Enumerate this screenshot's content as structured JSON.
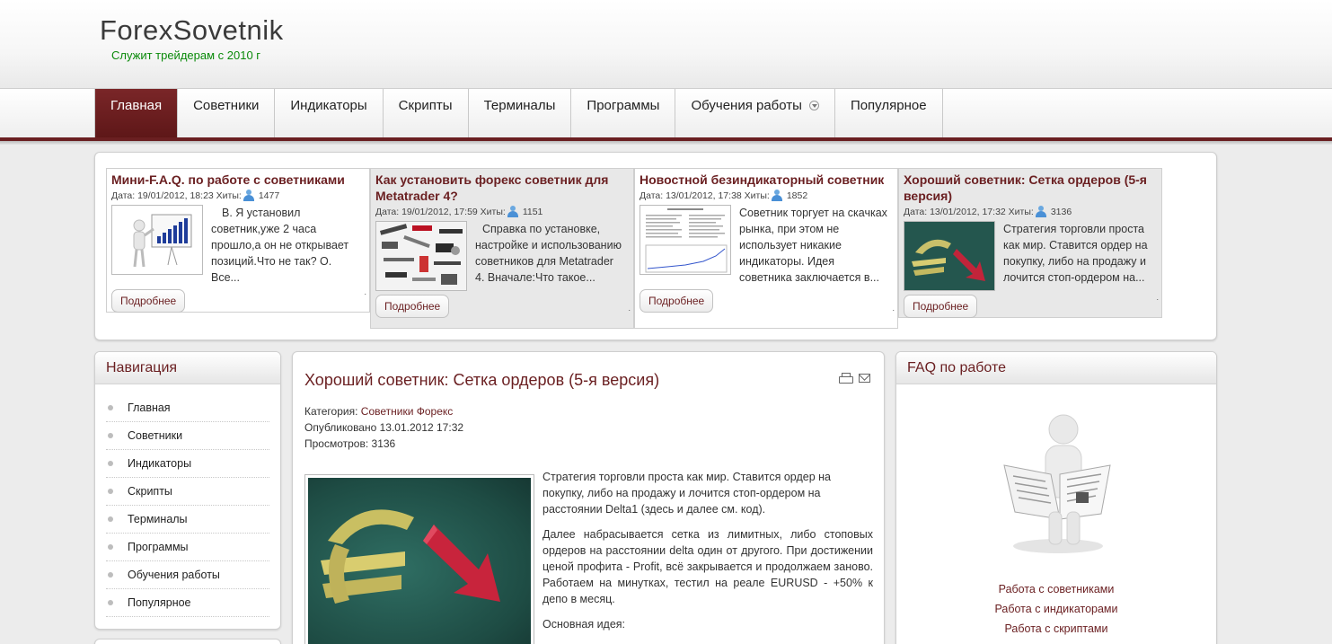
{
  "site": {
    "logo": "ForexSovetnik",
    "slogan": "Служит трейдерам с 2010 г"
  },
  "menu": [
    {
      "label": "Главная"
    },
    {
      "label": "Советники"
    },
    {
      "label": "Индикаторы"
    },
    {
      "label": "Скрипты"
    },
    {
      "label": "Терминалы"
    },
    {
      "label": "Программы"
    },
    {
      "label": "Обучения работы"
    },
    {
      "label": "Популярное"
    }
  ],
  "featured": [
    {
      "title": "Мини-F.A.Q. по работе с советниками",
      "meta": "Дата: 19/01/2012, 18:23 Хиты:",
      "hits": "1477",
      "text": "В. Я установил советник,уже 2 часа прошло,а он не открывает позиций.Что не так? О. Все...",
      "more": "Подробнее"
    },
    {
      "title": "Как установить форекс советник для Metatrader 4?",
      "meta": "Дата: 19/01/2012, 17:59 Хиты:",
      "hits": "1151",
      "text": "Справка по установке, настройке и использованию советников для Metatrader 4. Вначале:Что такое...",
      "more": "Подробнее"
    },
    {
      "title": "Новостной безиндикаторный советник",
      "meta": "Дата: 13/01/2012, 17:38 Хиты:",
      "hits": "1852",
      "text": "Советник торгует на скачках рынка, при этом не использует никакие индикаторы. Идея советника заключается в...",
      "more": "Подробнее"
    },
    {
      "title": "Хороший советник: Сетка ордеров (5-я версия)",
      "meta": "Дата: 13/01/2012, 17:32 Хиты:",
      "hits": "3136",
      "text": "Стратегия торговли проста как мир. Ставится ордер на покупку, либо на продажу и лочится стоп-ордером на...",
      "more": "Подробнее"
    }
  ],
  "sidebar_nav": {
    "title": "Навигация",
    "items": [
      {
        "label": "Главная"
      },
      {
        "label": "Советники"
      },
      {
        "label": "Индикаторы"
      },
      {
        "label": "Скрипты"
      },
      {
        "label": "Терминалы"
      },
      {
        "label": "Программы"
      },
      {
        "label": "Обучения работы"
      },
      {
        "label": "Популярное"
      }
    ]
  },
  "article": {
    "title": "Хороший советник: Сетка ордеров (5-я версия)",
    "category_label": "Категория:",
    "category": "Советники Форекс",
    "published": "Опубликовано 13.01.2012 17:32",
    "views": "Просмотров: 3136",
    "paragraphs": [
      "Стратегия торговли проста как мир. Ставится ордер на покупку, либо на продажу и лочится стоп-ордером на расстоянии Delta1 (здесь и далее см. код).",
      "Далее набрасывается сетка из лимитных, либо стоповых ордеров на расстоянии delta один от другого. При достижении ценой профита - Profit, всё закрывается и продолжаем заново. Работаем на минутках, тестил на реале EURUSD - +50% к депо в месяц.",
      "Основная идея:"
    ]
  },
  "faq": {
    "title": "FAQ по работе",
    "links": [
      {
        "label": "Работа с советниками"
      },
      {
        "label": "Работа с индикаторами"
      },
      {
        "label": "Работа с скриптами"
      }
    ]
  },
  "colors": {
    "brand": "#6a1f21",
    "slogan": "#0a8a0a"
  }
}
